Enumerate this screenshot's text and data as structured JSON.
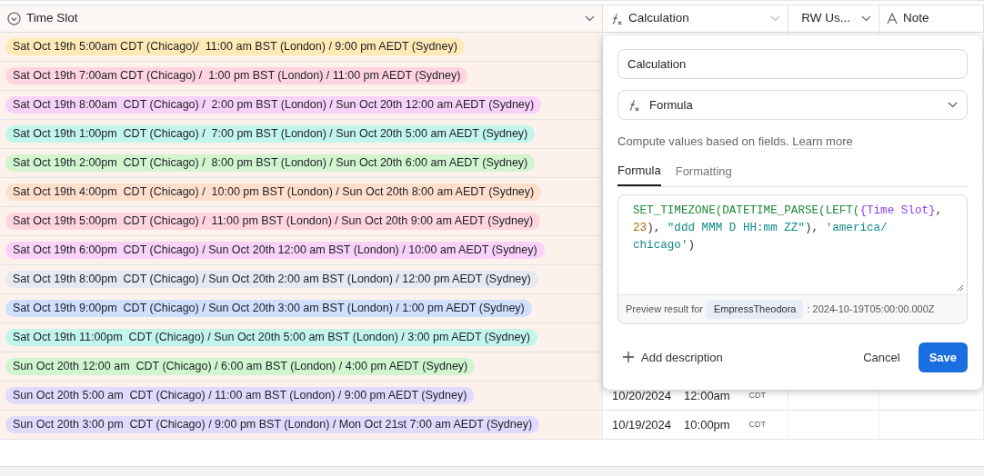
{
  "columns": [
    {
      "kind": "select",
      "label": "Time Slot"
    },
    {
      "kind": "formula",
      "label": "Calculation"
    },
    {
      "kind": "text",
      "label": "RW Us..."
    },
    {
      "kind": "text",
      "label": "Note"
    }
  ],
  "rows": [
    {
      "time_slot": "Sat Oct 19th 5:00am CDT (Chicago)/  11:00 am BST (London) / 9:00 pm AEDT (Sydney)",
      "color": "#ffeab6"
    },
    {
      "time_slot": "Sat Oct 19th 7:00am CDT (Chicago) /  1:00 pm BST (London) / 11:00 pm AEDT (Sydney)",
      "color": "#ffd4de"
    },
    {
      "time_slot": "Sat Oct 19th 8:00am  CDT (Chicago) /  2:00 pm BST (London) / Sun Oct 20th 12:00 am AEDT (Sydney)",
      "color": "#f9d2f9"
    },
    {
      "time_slot": "Sat Oct 19th 1:00pm  CDT (Chicago) /  7:00 pm BST (London) / Sun Oct 20th 5:00 am AEDT (Sydney)",
      "color": "#c2f5ec"
    },
    {
      "time_slot": "Sat Oct 19th 2:00pm  CDT (Chicago) /  8:00 pm BST (London) / Sun Oct 20th 6:00 am AEDT (Sydney)",
      "color": "#d1f5cf"
    },
    {
      "time_slot": "Sat Oct 19th 4:00pm  CDT (Chicago) /  10:00 pm BST (London) / Sun Oct 20th 8:00 am AEDT (Sydney)",
      "color": "#ffdfcb"
    },
    {
      "time_slot": "Sat Oct 19th 5:00pm  CDT (Chicago) /  11:00 pm BST (London) / Sun Oct 20th 9:00 am AEDT (Sydney)",
      "color": "#ffd4de"
    },
    {
      "time_slot": "Sat Oct 19th 6:00pm  CDT (Chicago) / Sun Oct 20th 12:00 am BST (London) / 10:00 am AEDT (Sydney)",
      "color": "#f9d2f9"
    },
    {
      "time_slot": "Sat Oct 19th 8:00pm  CDT (Chicago) / Sun Oct 20th 2:00 am BST (London) / 12:00 pm AEDT (Sydney)",
      "color": "#e5e9f0"
    },
    {
      "time_slot": "Sat Oct 19th 9:00pm  CDT (Chicago) / Sun Oct 20th 3:00 am BST (London) / 1:00 pm AEDT (Sydney)",
      "color": "#cfdfff"
    },
    {
      "time_slot": "Sat Oct 19th 11:00pm  CDT (Chicago) / Sun Oct 20th 5:00 am BST (London) / 3:00 pm AEDT (Sydney)",
      "color": "#c2f5ec"
    },
    {
      "time_slot": "Sun Oct 20th 12:00 am  CDT (Chicago) / 6:00 am BST (London) / 4:00 pm AEDT (Sydney)",
      "color": "#d1f5cf"
    },
    {
      "time_slot": "Sun Oct 20th 5:00 am  CDT (Chicago) / 11:00 am BST (London) / 9:00 pm AEDT (Sydney)",
      "color": "#e0dafd",
      "calculation": {
        "date": "10/20/2024",
        "time": "12:00am",
        "zone": "CDT"
      }
    },
    {
      "time_slot": "Sun Oct 20th 3:00 pm  CDT (Chicago) / 9:00 pm BST (London) / Mon Oct 21st 7:00 am AEDT (Sydney)",
      "color": "#e0dafd",
      "calculation": {
        "date": "10/19/2024",
        "time": "10:00pm",
        "zone": "CDT"
      }
    }
  ],
  "field_editor": {
    "name": "Calculation",
    "type": "Formula",
    "help": "Compute values based on fields.",
    "help_link": "Learn more",
    "tabs": [
      {
        "label": "Formula",
        "selected": true
      },
      {
        "label": "Formatting",
        "selected": false
      }
    ],
    "formula": [
      {
        "kind": "function",
        "text": "SET_TIMEZONE("
      },
      {
        "kind": "function",
        "text": "DATETIME_PARSE("
      },
      {
        "kind": "function",
        "text": "LEFT("
      },
      {
        "kind": "field",
        "text": "{Time Slot}"
      },
      {
        "kind": "punct",
        "text": ", "
      },
      {
        "kind": "number",
        "text": "23"
      },
      {
        "kind": "punct",
        "text": "), "
      },
      {
        "kind": "string",
        "text": "\"ddd MMM D HH:mm ZZ\""
      },
      {
        "kind": "punct",
        "text": "), "
      },
      {
        "kind": "string",
        "text": "'america/ chicago'"
      },
      {
        "kind": "punct",
        "text": ")"
      }
    ],
    "preview_label": "Preview result for",
    "preview_record": "EmpressTheodora",
    "preview_value": ": 2024-10-19T05:00:00.000Z",
    "add_description": "Add description",
    "cancel": "Cancel",
    "save": "Save"
  }
}
